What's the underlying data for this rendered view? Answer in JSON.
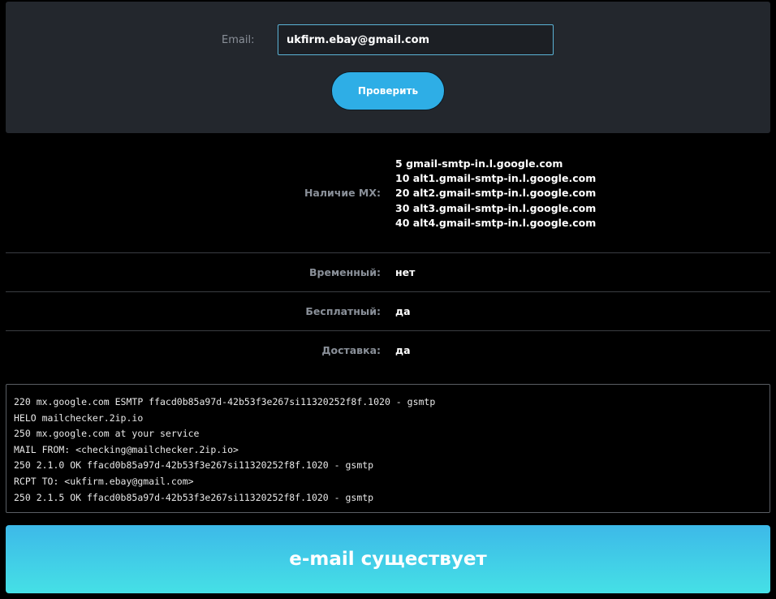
{
  "form": {
    "email_label": "Email:",
    "email_value": "ukfirm.ebay@gmail.com",
    "submit_label": "Проверить"
  },
  "results": {
    "mx": {
      "label": "Наличие MX:",
      "records": [
        {
          "priority": "5",
          "host": "gmail-smtp-in.l.google.com"
        },
        {
          "priority": "10",
          "host": "alt1.gmail-smtp-in.l.google.com"
        },
        {
          "priority": "20",
          "host": "alt2.gmail-smtp-in.l.google.com"
        },
        {
          "priority": "30",
          "host": "alt3.gmail-smtp-in.l.google.com"
        },
        {
          "priority": "40",
          "host": "alt4.gmail-smtp-in.l.google.com"
        }
      ]
    },
    "temporary": {
      "label": "Временный:",
      "value": "нет"
    },
    "free": {
      "label": "Бесплатный:",
      "value": "да"
    },
    "delivery": {
      "label": "Доставка:",
      "value": "да"
    }
  },
  "smtp_log": [
    "220 mx.google.com ESMTP ffacd0b85a97d-42b53f3e267si11320252f8f.1020 - gsmtp",
    "HELO mailchecker.2ip.io",
    "250 mx.google.com at your service",
    "MAIL FROM: <checking@mailchecker.2ip.io>",
    "250 2.1.0 OK ffacd0b85a97d-42b53f3e267si11320252f8f.1020 - gsmtp",
    "RCPT TO: <ukfirm.ebay@gmail.com>",
    "250 2.1.5 OK ffacd0b85a97d-42b53f3e267si11320252f8f.1020 - gsmtp"
  ],
  "result": {
    "message": "e-mail существует"
  }
}
